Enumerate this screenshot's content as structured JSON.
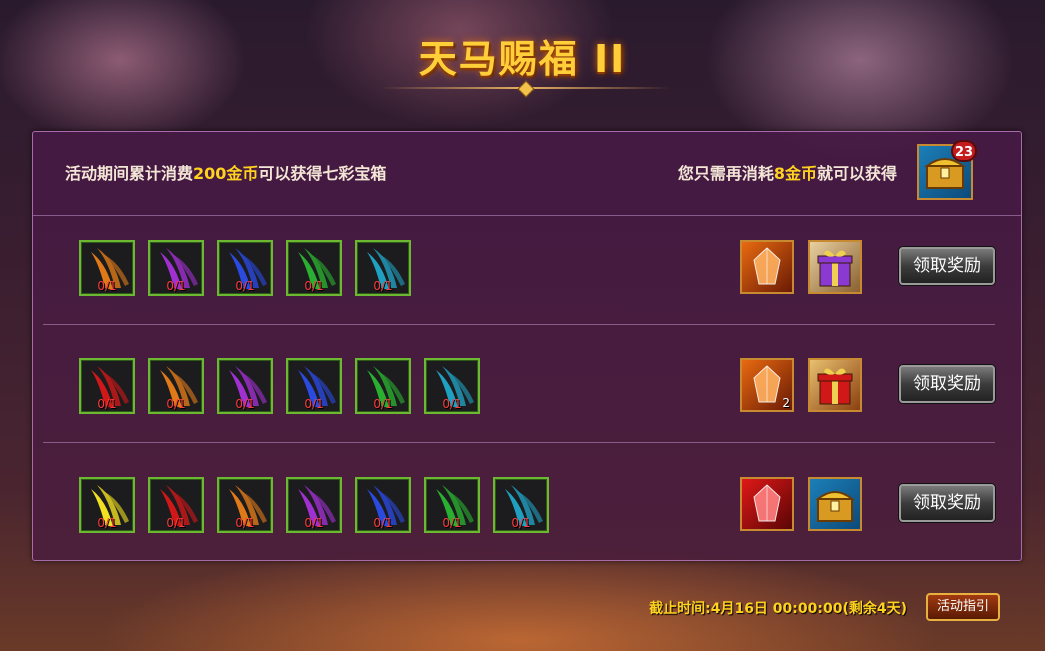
{
  "title": "天马赐福 II",
  "header": {
    "left_prefix": "活动期间累计消费",
    "left_amount": "200金币",
    "left_suffix": "可以获得七彩宝箱",
    "right_prefix": "您只需再消耗",
    "right_amount": "8金币",
    "right_suffix": "就可以获得",
    "chest_icon": "treasure-chest-icon",
    "chest_count": "23"
  },
  "rows": [
    {
      "items": [
        {
          "icon": "orange-feather-icon",
          "color": "#e07a18",
          "count": "0/1"
        },
        {
          "icon": "purple-feather-icon",
          "color": "#a030d0",
          "count": "0/1"
        },
        {
          "icon": "blue-feather-icon",
          "color": "#2a4ae0",
          "count": "0/1"
        },
        {
          "icon": "green-feather-icon",
          "color": "#2ab030",
          "count": "0/1"
        },
        {
          "icon": "cyan-feather-icon",
          "color": "#20a0c0",
          "count": "0/1"
        }
      ],
      "rewards": [
        {
          "icon": "orange-crystal-icon",
          "count": ""
        },
        {
          "icon": "purple-gift-box-icon",
          "count": ""
        }
      ],
      "claim_label": "领取奖励"
    },
    {
      "items": [
        {
          "icon": "red-feather-icon",
          "color": "#d01818",
          "count": "0/1"
        },
        {
          "icon": "orange-feather-icon",
          "color": "#e07a18",
          "count": "0/1"
        },
        {
          "icon": "purple-feather-icon",
          "color": "#a030d0",
          "count": "0/1"
        },
        {
          "icon": "blue-feather-icon",
          "color": "#2a4ae0",
          "count": "0/1"
        },
        {
          "icon": "green-feather-icon",
          "color": "#2ab030",
          "count": "0/1"
        },
        {
          "icon": "cyan-feather-icon",
          "color": "#20a0c0",
          "count": "0/1"
        }
      ],
      "rewards": [
        {
          "icon": "orange-crystal-icon",
          "count": "2"
        },
        {
          "icon": "red-gift-box-icon",
          "count": ""
        }
      ],
      "claim_label": "领取奖励"
    },
    {
      "items": [
        {
          "icon": "yellow-feather-icon",
          "color": "#f0e020",
          "count": "0/1"
        },
        {
          "icon": "red-feather-icon",
          "color": "#d01818",
          "count": "0/1"
        },
        {
          "icon": "orange-feather-icon",
          "color": "#e07a18",
          "count": "0/1"
        },
        {
          "icon": "purple-feather-icon",
          "color": "#a030d0",
          "count": "0/1"
        },
        {
          "icon": "blue-feather-icon",
          "color": "#2a4ae0",
          "count": "0/1"
        },
        {
          "icon": "green-feather-icon",
          "color": "#2ab030",
          "count": "0/1"
        },
        {
          "icon": "cyan-feather-icon",
          "color": "#20a0c0",
          "count": "0/1"
        }
      ],
      "rewards": [
        {
          "icon": "red-crystal-icon",
          "count": ""
        },
        {
          "icon": "treasure-chest-icon",
          "count": ""
        }
      ],
      "claim_label": "领取奖励"
    }
  ],
  "footer": {
    "deadline": "截止时间:4月16日 00:00:00(剩余4天)",
    "guide_label": "活动指引"
  }
}
